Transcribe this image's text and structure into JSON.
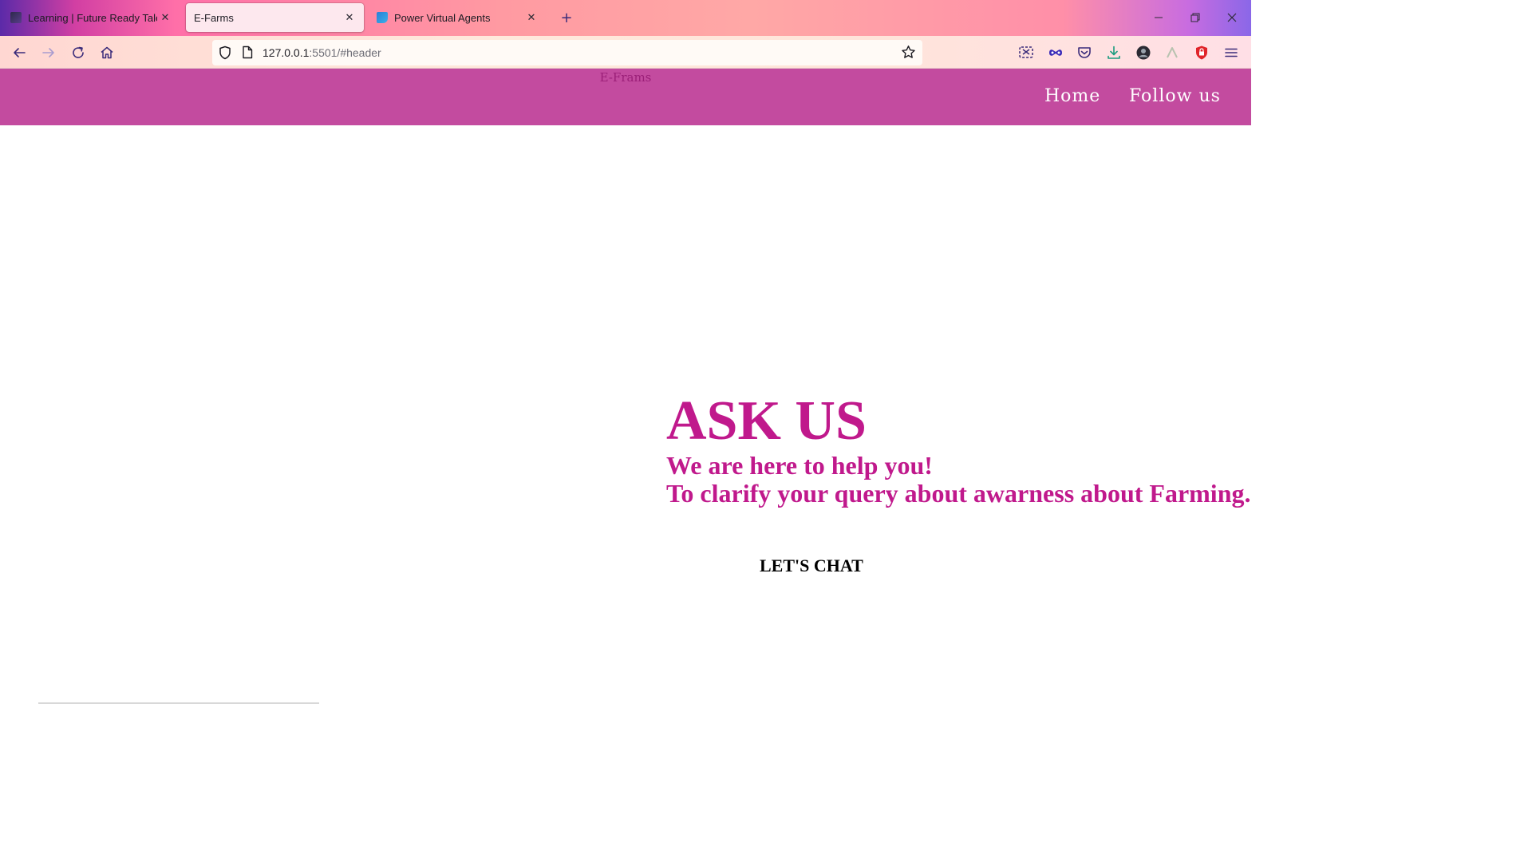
{
  "browser": {
    "tabs": [
      {
        "title": "Learning | Future Ready Talent",
        "active": false
      },
      {
        "title": "E-Farms",
        "active": true
      },
      {
        "title": "Power Virtual Agents",
        "active": false
      }
    ],
    "tab_close_glyph": "✕",
    "new_tab_glyph": "+",
    "url_host": "127.0.0.1",
    "url_rest": ":5501/#header",
    "icons": [
      "back-icon",
      "forward-icon",
      "reload-icon",
      "home-icon",
      "shield-icon",
      "page-icon",
      "bookmark-star-icon",
      "extension-icons",
      "menu-icon"
    ]
  },
  "site": {
    "brand": "E-Frams",
    "nav": {
      "home": "Home",
      "follow": "Follow us"
    },
    "header_color": "#c34b9f"
  },
  "hero": {
    "title": "ASK US",
    "subtitle_line1": "We are here to help you!",
    "subtitle_line2": "To clarify your query about awarness about Farming.",
    "accent_color": "#c0198c",
    "chat_button": "LET'S CHAT"
  }
}
